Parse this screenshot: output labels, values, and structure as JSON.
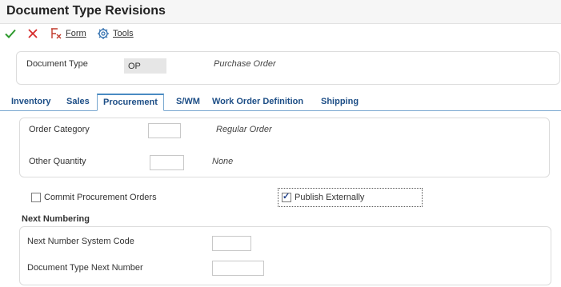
{
  "window": {
    "title": "Document Type Revisions"
  },
  "toolbar": {
    "ok_icon": "check-icon",
    "cancel_icon": "close-icon",
    "form_label": "Form",
    "tools_label": "Tools",
    "colors": {
      "ok": "#2e9a2e",
      "cancel": "#d62b2b",
      "form_icon": "#c0392b",
      "tools_icon": "#3572b0"
    }
  },
  "header": {
    "document_type_label": "Document Type",
    "document_type_value": "OP",
    "document_type_desc": "Purchase Order"
  },
  "tabs": [
    {
      "label": "Inventory",
      "active": false
    },
    {
      "label": "Sales",
      "active": false
    },
    {
      "label": "Procurement",
      "active": true
    },
    {
      "label": "S/WM",
      "active": false
    },
    {
      "label": "Work Order Definition",
      "active": false
    },
    {
      "label": "Shipping",
      "active": false
    }
  ],
  "procurement": {
    "order_category_label": "Order Category",
    "order_category_value": "",
    "order_category_desc": "Regular Order",
    "other_quantity_label": "Other Quantity",
    "other_quantity_value": "",
    "other_quantity_desc": "None",
    "commit_label": "Commit Procurement Orders",
    "commit_checked": false,
    "publish_label": "Publish Externally",
    "publish_checked": true
  },
  "next_numbering": {
    "title": "Next Numbering",
    "system_code_label": "Next Number System Code",
    "system_code_value": "",
    "doc_type_next_label": "Document Type Next Number",
    "doc_type_next_value": ""
  },
  "colors": {
    "tab_text": "#1d4e86",
    "tab_border": "#7aa8d0"
  }
}
